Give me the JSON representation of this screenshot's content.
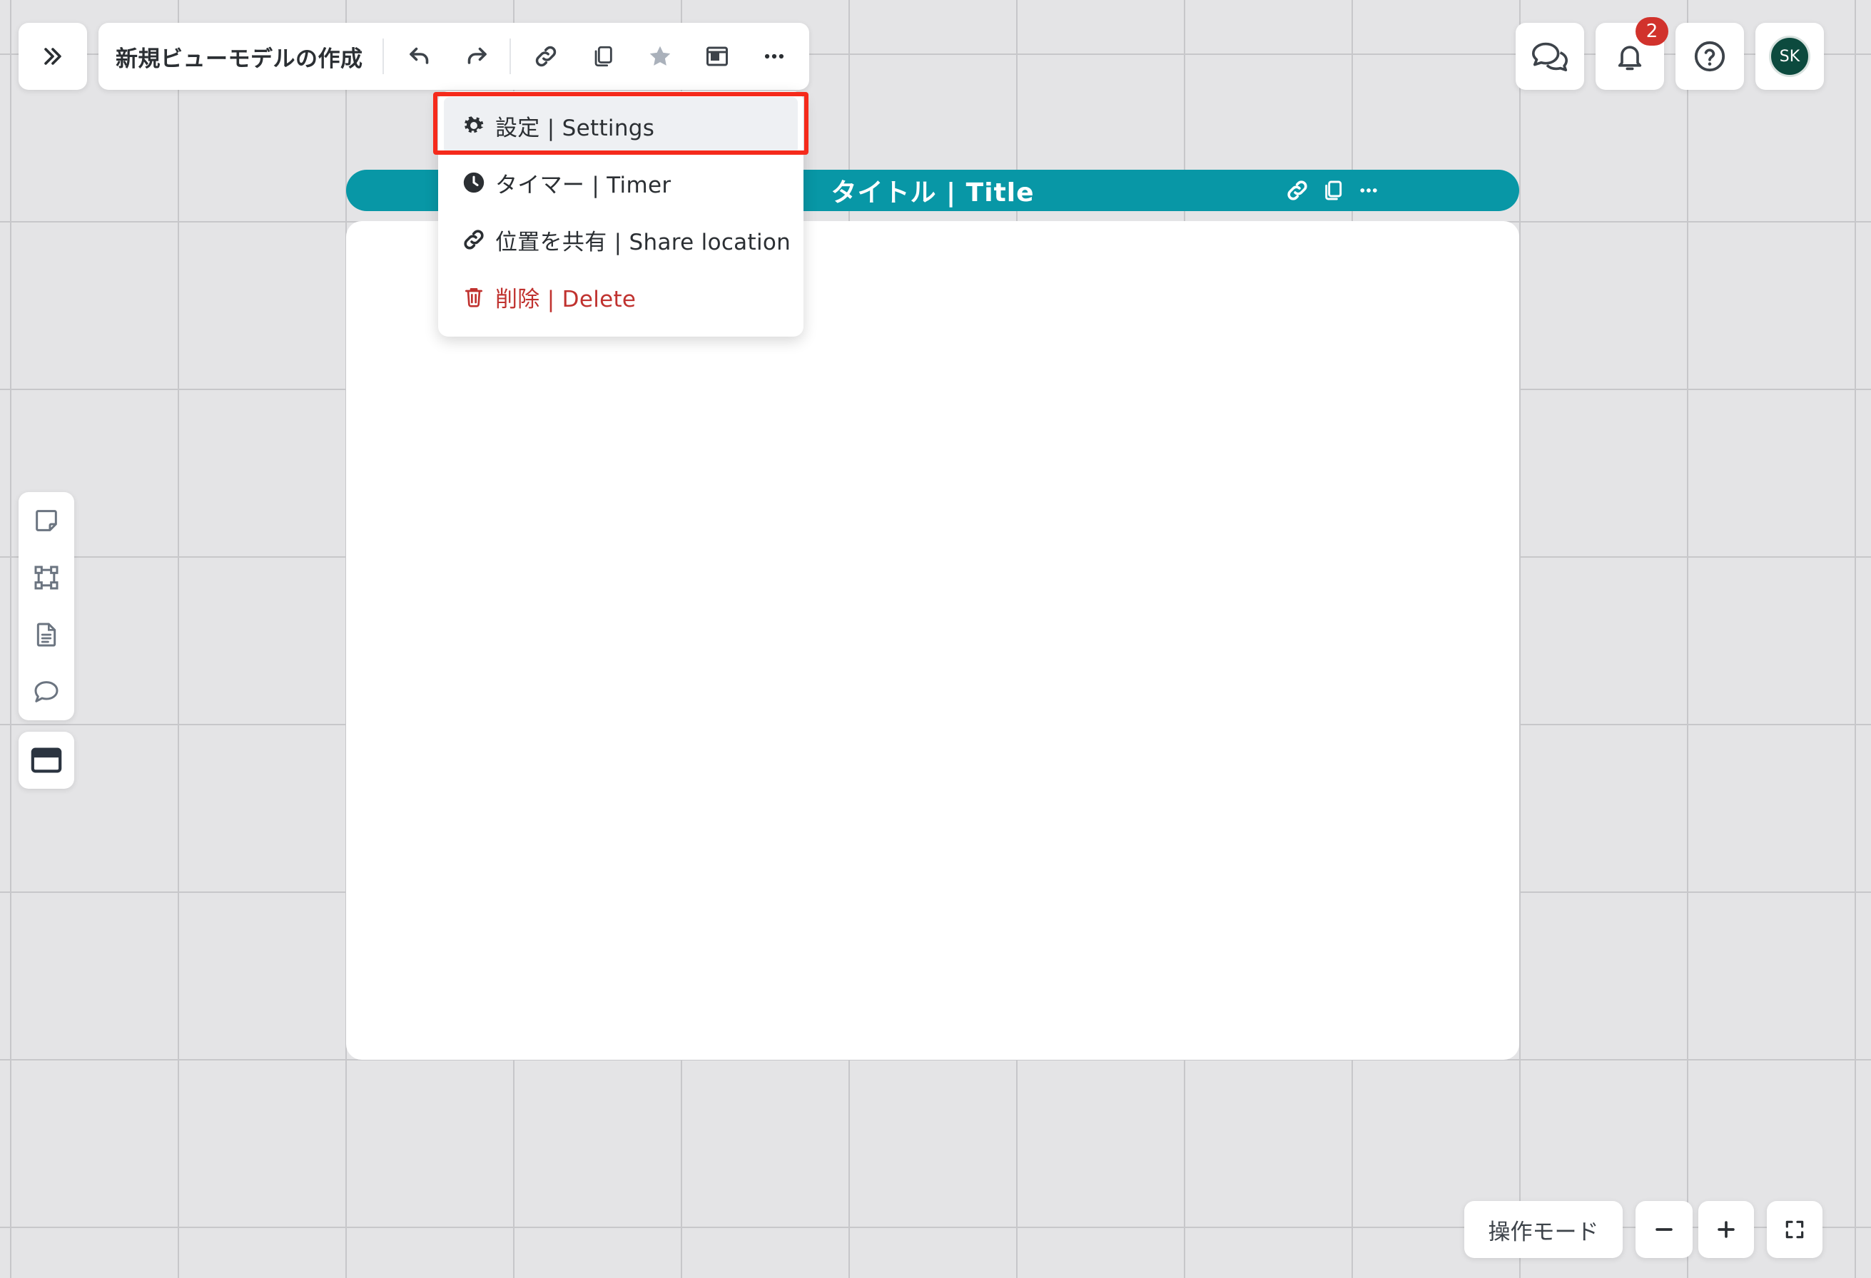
{
  "header": {
    "board_title": "新規ビューモデルの作成"
  },
  "menu": {
    "items": [
      {
        "label": "設定 | Settings",
        "icon": "gear-icon"
      },
      {
        "label": "タイマー | Timer",
        "icon": "clock-icon"
      },
      {
        "label": "位置を共有 | Share location",
        "icon": "link-icon"
      },
      {
        "label": "削除 | Delete",
        "icon": "trash-icon"
      }
    ]
  },
  "frame": {
    "title": "タイトル | Title"
  },
  "top_right": {
    "notification_count": "2",
    "avatar_initials": "SK"
  },
  "bottom": {
    "mode_label": "操作モード"
  },
  "colors": {
    "frame_header": "#0897a6",
    "highlight": "#f52a1b",
    "delete": "#c0322f",
    "badge": "#d1322c",
    "avatar": "#0c4a3e"
  }
}
